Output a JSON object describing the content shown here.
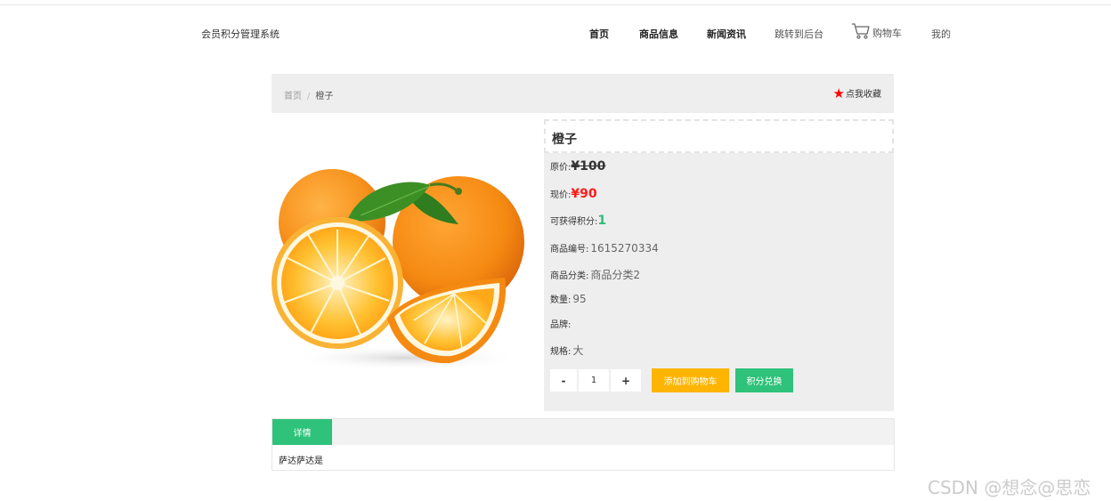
{
  "header": {
    "brand": "会员积分管理系统",
    "nav": {
      "home": "首页",
      "goods": "商品信息",
      "news": "新闻资讯",
      "backend": "跳转到后台",
      "cart": "购物车",
      "mine": "我的"
    }
  },
  "breadcrumb": {
    "home": "首页",
    "separator": "/",
    "current": "橙子",
    "favorite": "点我收藏"
  },
  "product": {
    "name": "橙子",
    "original_price_label": "原价:",
    "original_price": "¥100",
    "current_price_label": "现价:",
    "current_price": "¥90",
    "points_label": "可获得积分:",
    "points": "1",
    "code_label": "商品编号:",
    "code": "1615270334",
    "category_label": "商品分类:",
    "category": "商品分类2",
    "quantity_label": "数量:",
    "quantity": "95",
    "brand_label": "品牌:",
    "brand": "",
    "spec_label": "规格:",
    "spec": "大",
    "image_icon": "orange-fruit-image"
  },
  "purchase": {
    "minus": "-",
    "qty": "1",
    "plus": "+",
    "add_to_cart": "添加到购物车",
    "redeem": "积分兑换"
  },
  "detail": {
    "tab": "详情",
    "content": "萨达萨达是"
  },
  "watermark": "CSDN @想念@思恋",
  "colors": {
    "accent_green": "#2fc27a",
    "accent_orange": "#ffb400",
    "price_red": "#ff1b1b",
    "star_red": "#ff0000"
  }
}
